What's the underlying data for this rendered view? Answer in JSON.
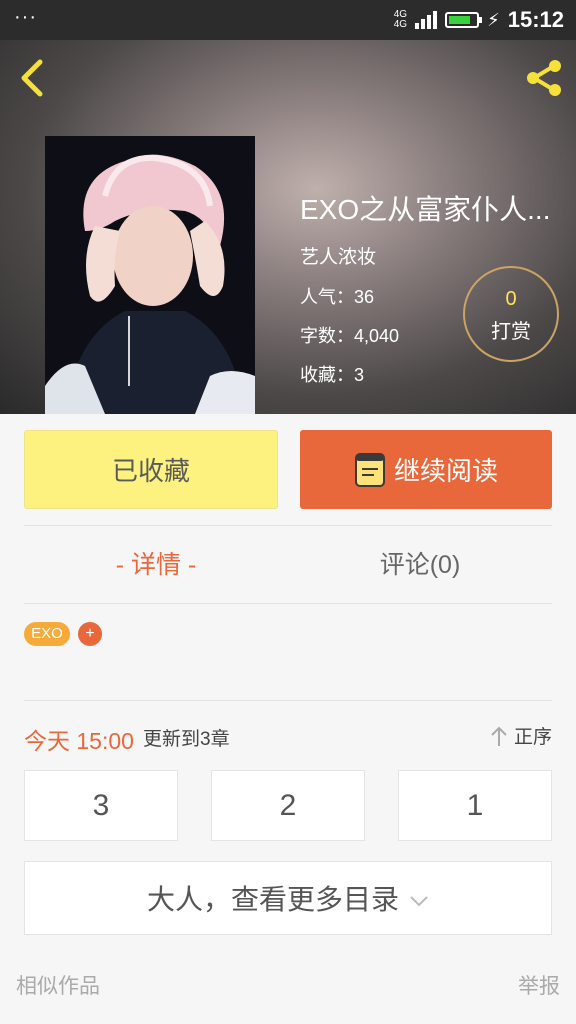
{
  "status_bar": {
    "dots": "···",
    "network": "4G",
    "network2": "4G",
    "time": "15:12",
    "battery_level": 0.8
  },
  "header": {
    "title": "EXO之从富家仆人...",
    "author": "艺人浓妆",
    "popularity_label": "人气：",
    "popularity_value": "36",
    "words_label": "字数：",
    "words_value": "4,040",
    "collections_label": "收藏：",
    "collections_value": "3",
    "reward_count": "0",
    "reward_label": "打赏"
  },
  "actions": {
    "collect_label": "已收藏",
    "read_label": "继续阅读"
  },
  "tabs": {
    "details": "- 详情 -",
    "comments": "评论(0)"
  },
  "tags": {
    "tag1": "EXO",
    "add": "+"
  },
  "update": {
    "time": "今天 15:00",
    "text": "更新到3章",
    "sort_label": "正序"
  },
  "chapters": [
    "3",
    "2",
    "1"
  ],
  "more_label": "大人，查看更多目录",
  "footer": {
    "similar": "相似作品",
    "report": "举报"
  },
  "colors": {
    "accent": "#e8683b",
    "collect_bg": "#fdf27f",
    "tag": "#f6aa3a"
  }
}
